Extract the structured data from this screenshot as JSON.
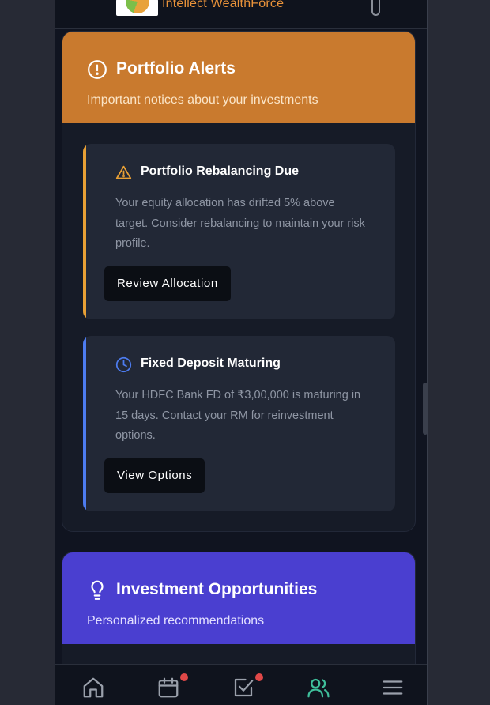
{
  "app": {
    "brand": "Intellect WealthForce"
  },
  "colors": {
    "alerts_header": "#c97a2e",
    "opportunities_header": "#4a3fd0",
    "warning_accent": "#e8a035",
    "info_accent": "#4d7cf0",
    "badge": "#e04848",
    "active_nav": "#3fbf9b"
  },
  "alerts_section": {
    "icon": "alert-circle-icon",
    "title": "Portfolio Alerts",
    "subtitle": "Important notices about your investments",
    "items": [
      {
        "icon": "warning-triangle-icon",
        "title": "Portfolio Rebalancing Due",
        "body": "Your equity allocation has drifted 5% above target. Consider rebalancing to maintain your risk profile.",
        "button": "Review Allocation"
      },
      {
        "icon": "clock-icon",
        "title": "Fixed Deposit Maturing",
        "body": "Your HDFC Bank FD of ₹3,00,000 is maturing in 15 days. Contact your RM for reinvestment options.",
        "button": "View Options"
      }
    ]
  },
  "opportunities_section": {
    "icon": "lightbulb-icon",
    "title": "Investment Opportunities",
    "subtitle": "Personalized recommendations"
  },
  "bottom_nav": [
    {
      "name": "home-icon",
      "badge": false
    },
    {
      "name": "calendar-icon",
      "badge": true
    },
    {
      "name": "tasks-icon",
      "badge": true
    },
    {
      "name": "clients-icon",
      "badge": false,
      "active": true
    },
    {
      "name": "menu-icon",
      "badge": false
    }
  ]
}
